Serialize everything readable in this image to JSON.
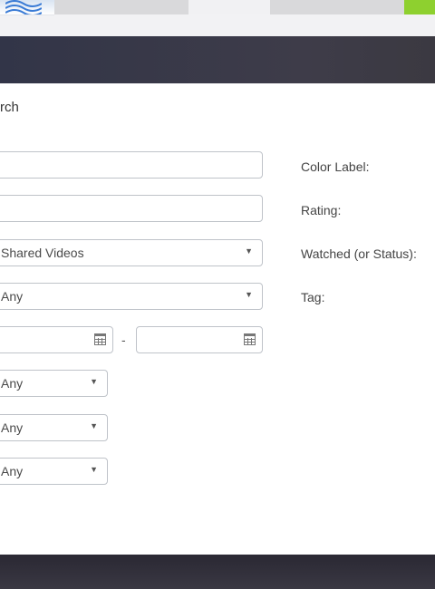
{
  "dialog": {
    "title_fragment": "rch"
  },
  "fields": {
    "name_value": "",
    "path_value": "",
    "shared_folder_value": "Shared Videos",
    "type_value": "Any",
    "date_from_value": "",
    "date_separator": "-",
    "date_to_value": "",
    "select_1_value": "Any",
    "select_2_value": "Any",
    "select_3_value": "Any"
  },
  "right_labels": {
    "color_label": "Color Label:",
    "rating": "Rating:",
    "watched": "Watched (or Status):",
    "tag": "Tag:"
  },
  "icons": {
    "dropdown": "caret-down-icon",
    "calendar": "calendar-icon"
  },
  "colors": {
    "header": "#35364a",
    "panel": "#ffffff",
    "accent_green": "#8ed02f"
  }
}
